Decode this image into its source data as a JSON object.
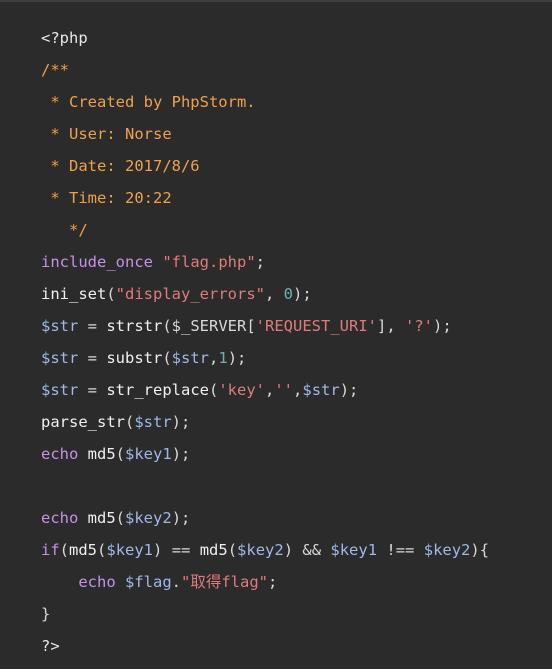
{
  "editor": {
    "lines": [
      [
        {
          "t": "<?php",
          "c": "tag"
        }
      ],
      [
        {
          "t": "/**",
          "c": "cmt"
        }
      ],
      [
        {
          "t": " * Created by PhpStorm.",
          "c": "cmt"
        }
      ],
      [
        {
          "t": " * User: Norse",
          "c": "cmt"
        }
      ],
      [
        {
          "t": " * Date: 2017/8/6",
          "c": "cmt"
        }
      ],
      [
        {
          "t": " * Time: 20:22",
          "c": "cmt"
        }
      ],
      [
        {
          "t": "   */",
          "c": "cmt"
        }
      ],
      [
        {
          "t": "include_once",
          "c": "kw"
        },
        {
          "t": " ",
          "c": "p"
        },
        {
          "t": "\"flag.php\"",
          "c": "str"
        },
        {
          "t": ";",
          "c": "p"
        }
      ],
      [
        {
          "t": "ini_set",
          "c": "fn"
        },
        {
          "t": "(",
          "c": "p"
        },
        {
          "t": "\"display_errors\"",
          "c": "str"
        },
        {
          "t": ", ",
          "c": "p"
        },
        {
          "t": "0",
          "c": "num"
        },
        {
          "t": ");",
          "c": "p"
        }
      ],
      [
        {
          "t": "$str",
          "c": "var"
        },
        {
          "t": " = ",
          "c": "p"
        },
        {
          "t": "strstr",
          "c": "fn"
        },
        {
          "t": "(",
          "c": "p"
        },
        {
          "t": "$_SERVER",
          "c": "p"
        },
        {
          "t": "[",
          "c": "p"
        },
        {
          "t": "'REQUEST_URI'",
          "c": "str"
        },
        {
          "t": "], ",
          "c": "p"
        },
        {
          "t": "'?'",
          "c": "str"
        },
        {
          "t": ");",
          "c": "p"
        }
      ],
      [
        {
          "t": "$str",
          "c": "var"
        },
        {
          "t": " = ",
          "c": "p"
        },
        {
          "t": "substr",
          "c": "fn"
        },
        {
          "t": "(",
          "c": "p"
        },
        {
          "t": "$str",
          "c": "var"
        },
        {
          "t": ",",
          "c": "p"
        },
        {
          "t": "1",
          "c": "num"
        },
        {
          "t": ");",
          "c": "p"
        }
      ],
      [
        {
          "t": "$str",
          "c": "var"
        },
        {
          "t": " = ",
          "c": "p"
        },
        {
          "t": "str_replace",
          "c": "fn"
        },
        {
          "t": "(",
          "c": "p"
        },
        {
          "t": "'key'",
          "c": "str"
        },
        {
          "t": ",",
          "c": "p"
        },
        {
          "t": "''",
          "c": "str"
        },
        {
          "t": ",",
          "c": "p"
        },
        {
          "t": "$str",
          "c": "var"
        },
        {
          "t": ");",
          "c": "p"
        }
      ],
      [
        {
          "t": "parse_str",
          "c": "fn"
        },
        {
          "t": "(",
          "c": "p"
        },
        {
          "t": "$str",
          "c": "var"
        },
        {
          "t": ");",
          "c": "p"
        }
      ],
      [
        {
          "t": "echo",
          "c": "kw"
        },
        {
          "t": " ",
          "c": "p"
        },
        {
          "t": "md5",
          "c": "fn"
        },
        {
          "t": "(",
          "c": "p"
        },
        {
          "t": "$key1",
          "c": "var"
        },
        {
          "t": ");",
          "c": "p"
        }
      ],
      [
        {
          "t": "",
          "c": "p"
        }
      ],
      [
        {
          "t": "echo",
          "c": "kw"
        },
        {
          "t": " ",
          "c": "p"
        },
        {
          "t": "md5",
          "c": "fn"
        },
        {
          "t": "(",
          "c": "p"
        },
        {
          "t": "$key2",
          "c": "var"
        },
        {
          "t": ");",
          "c": "p"
        }
      ],
      [
        {
          "t": "if",
          "c": "kw"
        },
        {
          "t": "(",
          "c": "p"
        },
        {
          "t": "md5",
          "c": "fn"
        },
        {
          "t": "(",
          "c": "p"
        },
        {
          "t": "$key1",
          "c": "var"
        },
        {
          "t": ") == ",
          "c": "p"
        },
        {
          "t": "md5",
          "c": "fn"
        },
        {
          "t": "(",
          "c": "p"
        },
        {
          "t": "$key2",
          "c": "var"
        },
        {
          "t": ") && ",
          "c": "p"
        },
        {
          "t": "$key1",
          "c": "var"
        },
        {
          "t": " !== ",
          "c": "p"
        },
        {
          "t": "$key2",
          "c": "var"
        },
        {
          "t": "){",
          "c": "p"
        }
      ],
      [
        {
          "t": "    ",
          "c": "p"
        },
        {
          "t": "echo",
          "c": "kw"
        },
        {
          "t": " ",
          "c": "p"
        },
        {
          "t": "$flag",
          "c": "var"
        },
        {
          "t": ".",
          "c": "p"
        },
        {
          "t": "\"取得flag\"",
          "c": "str"
        },
        {
          "t": ";",
          "c": "p"
        }
      ],
      [
        {
          "t": "}",
          "c": "p"
        }
      ],
      [
        {
          "t": "?>",
          "c": "tag"
        }
      ]
    ]
  }
}
